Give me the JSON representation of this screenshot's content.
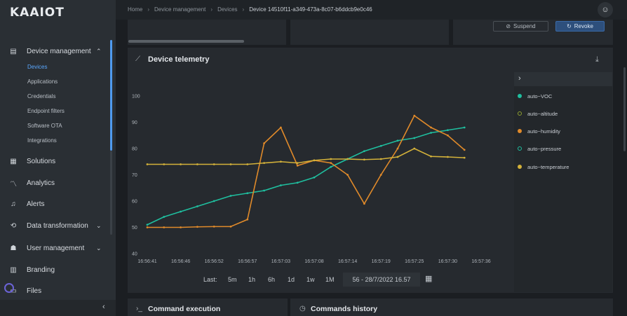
{
  "app": {
    "logo": "KAAIOT"
  },
  "sidebar": {
    "device_management": "Device management",
    "sub_items": [
      "Devices",
      "Applications",
      "Credentials",
      "Endpoint filters",
      "Software OTA",
      "Integrations"
    ],
    "active_sub": "Devices",
    "items": [
      {
        "label": "Solutions",
        "icon": "grid-icon"
      },
      {
        "label": "Analytics",
        "icon": "analytics-icon"
      },
      {
        "label": "Alerts",
        "icon": "bell-icon"
      },
      {
        "label": "Data transformation",
        "icon": "transform-icon"
      },
      {
        "label": "User management",
        "icon": "users-icon"
      },
      {
        "label": "Branding",
        "icon": "branding-icon"
      },
      {
        "label": "Files",
        "icon": "files-icon"
      }
    ]
  },
  "breadcrumb": {
    "items": [
      "Home",
      "Device management",
      "Devices"
    ],
    "current": "Device 14510f11-a349-473a-8c07-b6ddcb9e0c46"
  },
  "actions": {
    "suspend": "Suspend",
    "revoke": "Revoke"
  },
  "telemetry": {
    "title": "Device telemetry",
    "legend": [
      {
        "label": "auto~VOC",
        "color": "#1fbf9f",
        "hollow": false
      },
      {
        "label": "auto~altitude",
        "color": "#8fa030",
        "hollow": true
      },
      {
        "label": "auto~humidity",
        "color": "#e08a2a",
        "hollow": false
      },
      {
        "label": "auto~pressure",
        "color": "#1fbf9f",
        "hollow": true
      },
      {
        "label": "auto~temperature",
        "color": "#d4b23a",
        "hollow": false
      }
    ],
    "range_label": "Last:",
    "ranges": [
      "5m",
      "1h",
      "6h",
      "1d",
      "1w",
      "1M"
    ],
    "range_value": "56 - 28/7/2022 16.57"
  },
  "chart_data": {
    "type": "line",
    "x": [
      "16:56:41",
      "16:56:44",
      "16:56:46",
      "16:56:49",
      "16:56:52",
      "16:56:55",
      "16:56:57",
      "16:57:00",
      "16:57:03",
      "16:57:06",
      "16:57:08",
      "16:57:11",
      "16:57:14",
      "16:57:17",
      "16:57:19",
      "16:57:22",
      "16:57:25",
      "16:57:28",
      "16:57:30",
      "16:57:33",
      "16:57:36"
    ],
    "xticks": [
      "16:56:41",
      "16:56:46",
      "16:56:52",
      "16:56:57",
      "16:57:03",
      "16:57:08",
      "16:57:14",
      "16:57:19",
      "16:57:25",
      "16:57:30",
      "16:57:36"
    ],
    "yticks": [
      40,
      50,
      60,
      70,
      80,
      90,
      100
    ],
    "ylim": [
      40,
      100
    ],
    "grid": false,
    "series": [
      {
        "name": "auto~VOC",
        "color": "#1fbf9f",
        "values": [
          51,
          54,
          56,
          58,
          60,
          62,
          63,
          64,
          66,
          67,
          69,
          73,
          76,
          79,
          81,
          83,
          84,
          86,
          87,
          88,
          null
        ]
      },
      {
        "name": "auto~humidity",
        "color": "#e08a2a",
        "values": [
          50,
          50,
          50,
          50.2,
          50.3,
          50.3,
          53,
          82,
          88,
          73.5,
          75.5,
          74.5,
          70,
          59,
          70,
          80,
          92.5,
          88,
          85,
          79.5,
          null
        ]
      },
      {
        "name": "auto~temperature",
        "color": "#d4b23a",
        "values": [
          74,
          74,
          74,
          74,
          74,
          74,
          74,
          74.5,
          75,
          74.5,
          75.5,
          76,
          76,
          75.8,
          76,
          76.8,
          80,
          77,
          76.8,
          76.5,
          null
        ]
      }
    ]
  },
  "bottom": {
    "command_execution": "Command execution",
    "commands_history": "Commands history"
  }
}
